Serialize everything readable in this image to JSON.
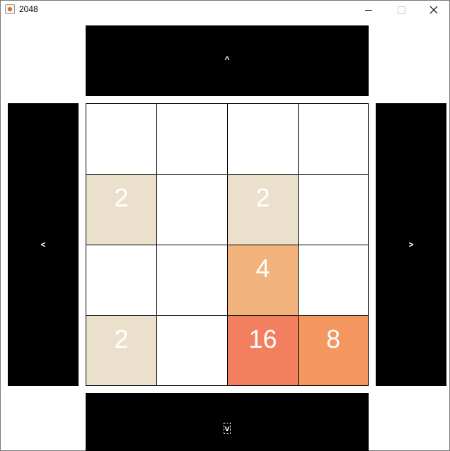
{
  "window": {
    "title": "2048",
    "icon": "java-cup-icon"
  },
  "controls": {
    "up_label": "^",
    "down_label": "v",
    "left_label": "<",
    "right_label": ">"
  },
  "board": {
    "tiles": [
      {
        "value": "",
        "color": "#ffffff"
      },
      {
        "value": "",
        "color": "#ffffff"
      },
      {
        "value": "",
        "color": "#ffffff"
      },
      {
        "value": "",
        "color": "#ffffff"
      },
      {
        "value": "2",
        "color": "#ebe0cc"
      },
      {
        "value": "",
        "color": "#ffffff"
      },
      {
        "value": "2",
        "color": "#ebe0cc"
      },
      {
        "value": "",
        "color": "#ffffff"
      },
      {
        "value": "",
        "color": "#ffffff"
      },
      {
        "value": "",
        "color": "#ffffff"
      },
      {
        "value": "4",
        "color": "#f2b27c"
      },
      {
        "value": "",
        "color": "#ffffff"
      },
      {
        "value": "2",
        "color": "#ebe0cc"
      },
      {
        "value": "",
        "color": "#ffffff"
      },
      {
        "value": "16",
        "color": "#f37f61"
      },
      {
        "value": "8",
        "color": "#f3975f"
      }
    ]
  }
}
